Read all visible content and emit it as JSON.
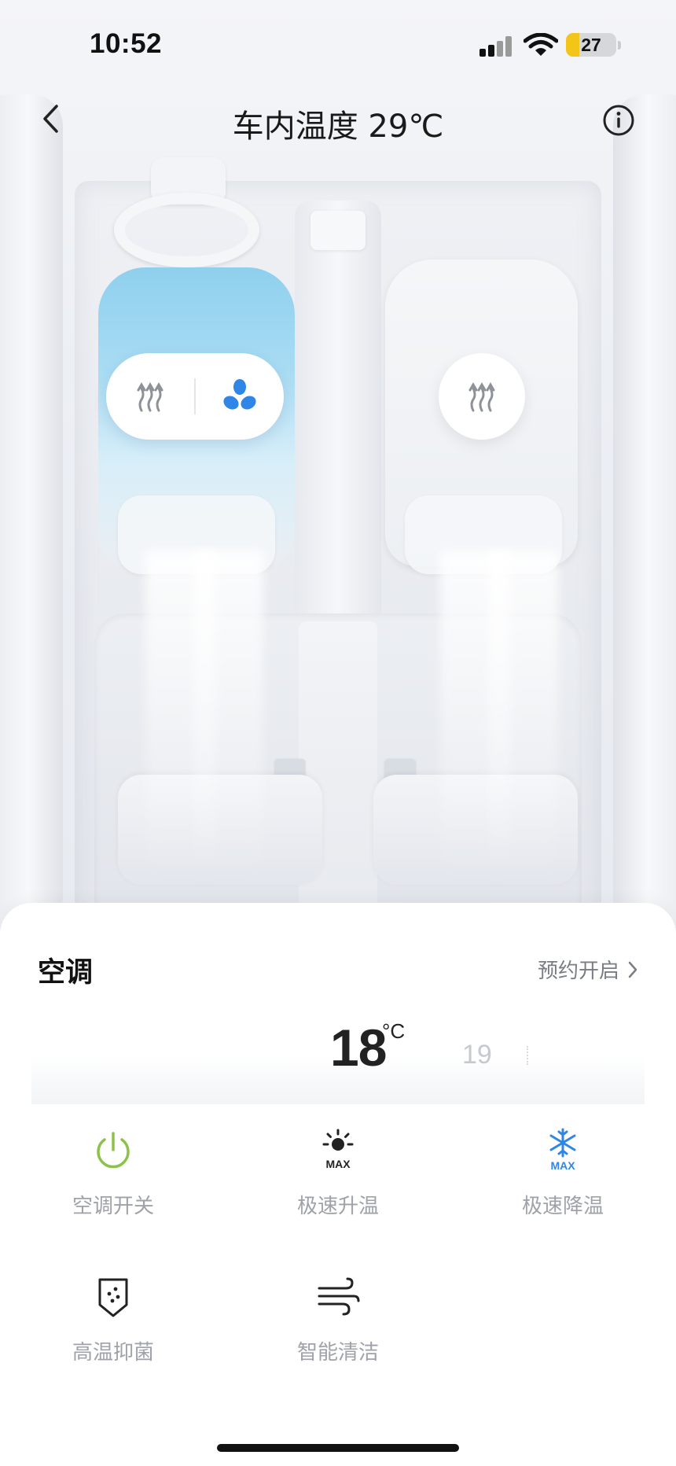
{
  "status_bar": {
    "time": "10:52",
    "battery": "27",
    "battery_level": 0.27
  },
  "header": {
    "title": "车内温度 29℃",
    "back_icon": "chevron-left-icon",
    "info_icon": "info-circle-icon"
  },
  "seats": {
    "driver": {
      "heat_icon": "seat-heat-icon",
      "vent_icon": "fan-icon",
      "vent_active": true,
      "vent_color": "#2f86e6"
    },
    "passenger": {
      "heat_icon": "seat-heat-icon"
    }
  },
  "ac": {
    "section_title": "空调",
    "schedule_label": "预约开启",
    "temp_selected": "18",
    "temp_unit": "°C",
    "temp_next": "19",
    "actions": [
      {
        "label": "空调开关",
        "icon": "power-icon",
        "color": "#8bc34a"
      },
      {
        "label": "极速升温",
        "icon": "sun-max-icon",
        "color": "#222222"
      },
      {
        "label": "极速降温",
        "icon": "snowflake-max-icon",
        "color": "#2f86e6"
      },
      {
        "label": "高温抑菌",
        "icon": "shield-dots-icon",
        "color": "#222222"
      },
      {
        "label": "智能清洁",
        "icon": "wind-icon",
        "color": "#222222"
      }
    ],
    "max_text": "MAX"
  }
}
